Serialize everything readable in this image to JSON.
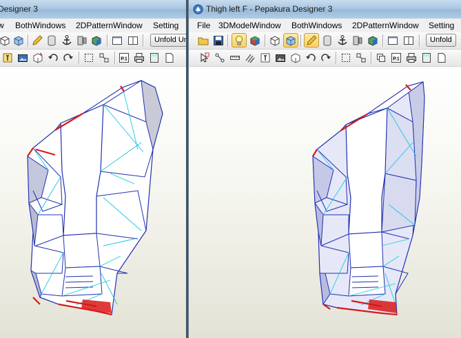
{
  "left_window": {
    "title": "Designer 3",
    "menu": [
      "w",
      "BothWindows",
      "2DPatternWindow",
      "Setting"
    ],
    "unfold_button": "Unfold Un"
  },
  "right_window": {
    "title": "Thigh left F - Pepakura Designer 3",
    "menu": [
      "File",
      "3DModelWindow",
      "BothWindows",
      "2DPatternWindow",
      "Setting"
    ],
    "unfold_button": "Unfold"
  },
  "toolbar_labels": {
    "page_icon": "P.1"
  },
  "colors": {
    "wire": "#1f2fb0",
    "seam": "#19c7e0",
    "cut": "#d81818",
    "title_bar": "#a9c7e2"
  }
}
